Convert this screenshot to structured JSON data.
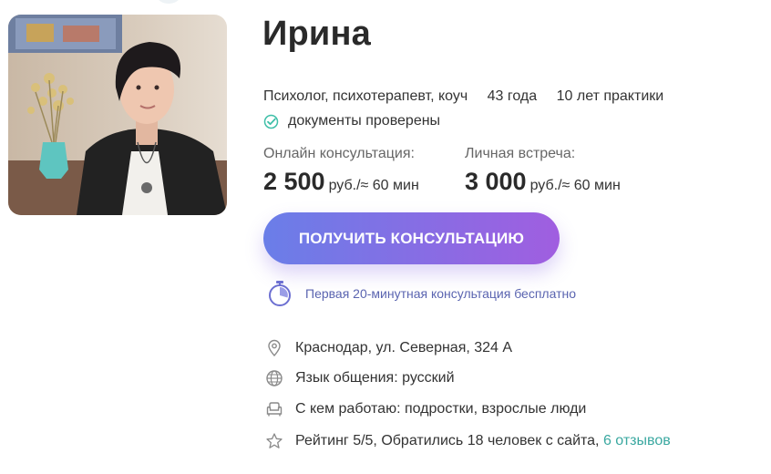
{
  "profile": {
    "name": "Ирина",
    "profession": "Психолог, психотерапевт, коуч",
    "age": "43 года",
    "experience": "10 лет практики",
    "verified_text": "документы проверены",
    "photo_icon": "psychologist-photo"
  },
  "prices": {
    "online": {
      "label": "Онлайн консультация:",
      "amount": "2 500",
      "unit": "руб./≈ 60 мин"
    },
    "in_person": {
      "label": "Личная встреча:",
      "amount": "3 000",
      "unit": "руб./≈ 60 мин"
    }
  },
  "cta": {
    "label": "ПОЛУЧИТЬ КОНСУЛЬТАЦИЮ"
  },
  "free_note": {
    "icon": "stopwatch-icon",
    "text": "Первая 20-минутная консультация бесплатно"
  },
  "info": {
    "address": {
      "icon": "location-pin-icon",
      "text": "Краснодар, ул. Северная, 324 А"
    },
    "language": {
      "icon": "globe-icon",
      "text": "Язык общения: русский"
    },
    "works_with": {
      "icon": "armchair-icon",
      "text": "С кем работаю: подростки, взрослые люди"
    },
    "rating": {
      "icon": "star-icon",
      "text": "Рейтинг 5/5, Обратились 18 человек с сайта,",
      "reviews_link": "6 отзывов"
    }
  },
  "colors": {
    "accent_gradient_start": "#6a7ee8",
    "accent_gradient_end": "#a05ee0",
    "verified_check": "#3fbfa8",
    "reviews_link": "#3aa8a0",
    "free_note_text": "#5a64b0"
  }
}
